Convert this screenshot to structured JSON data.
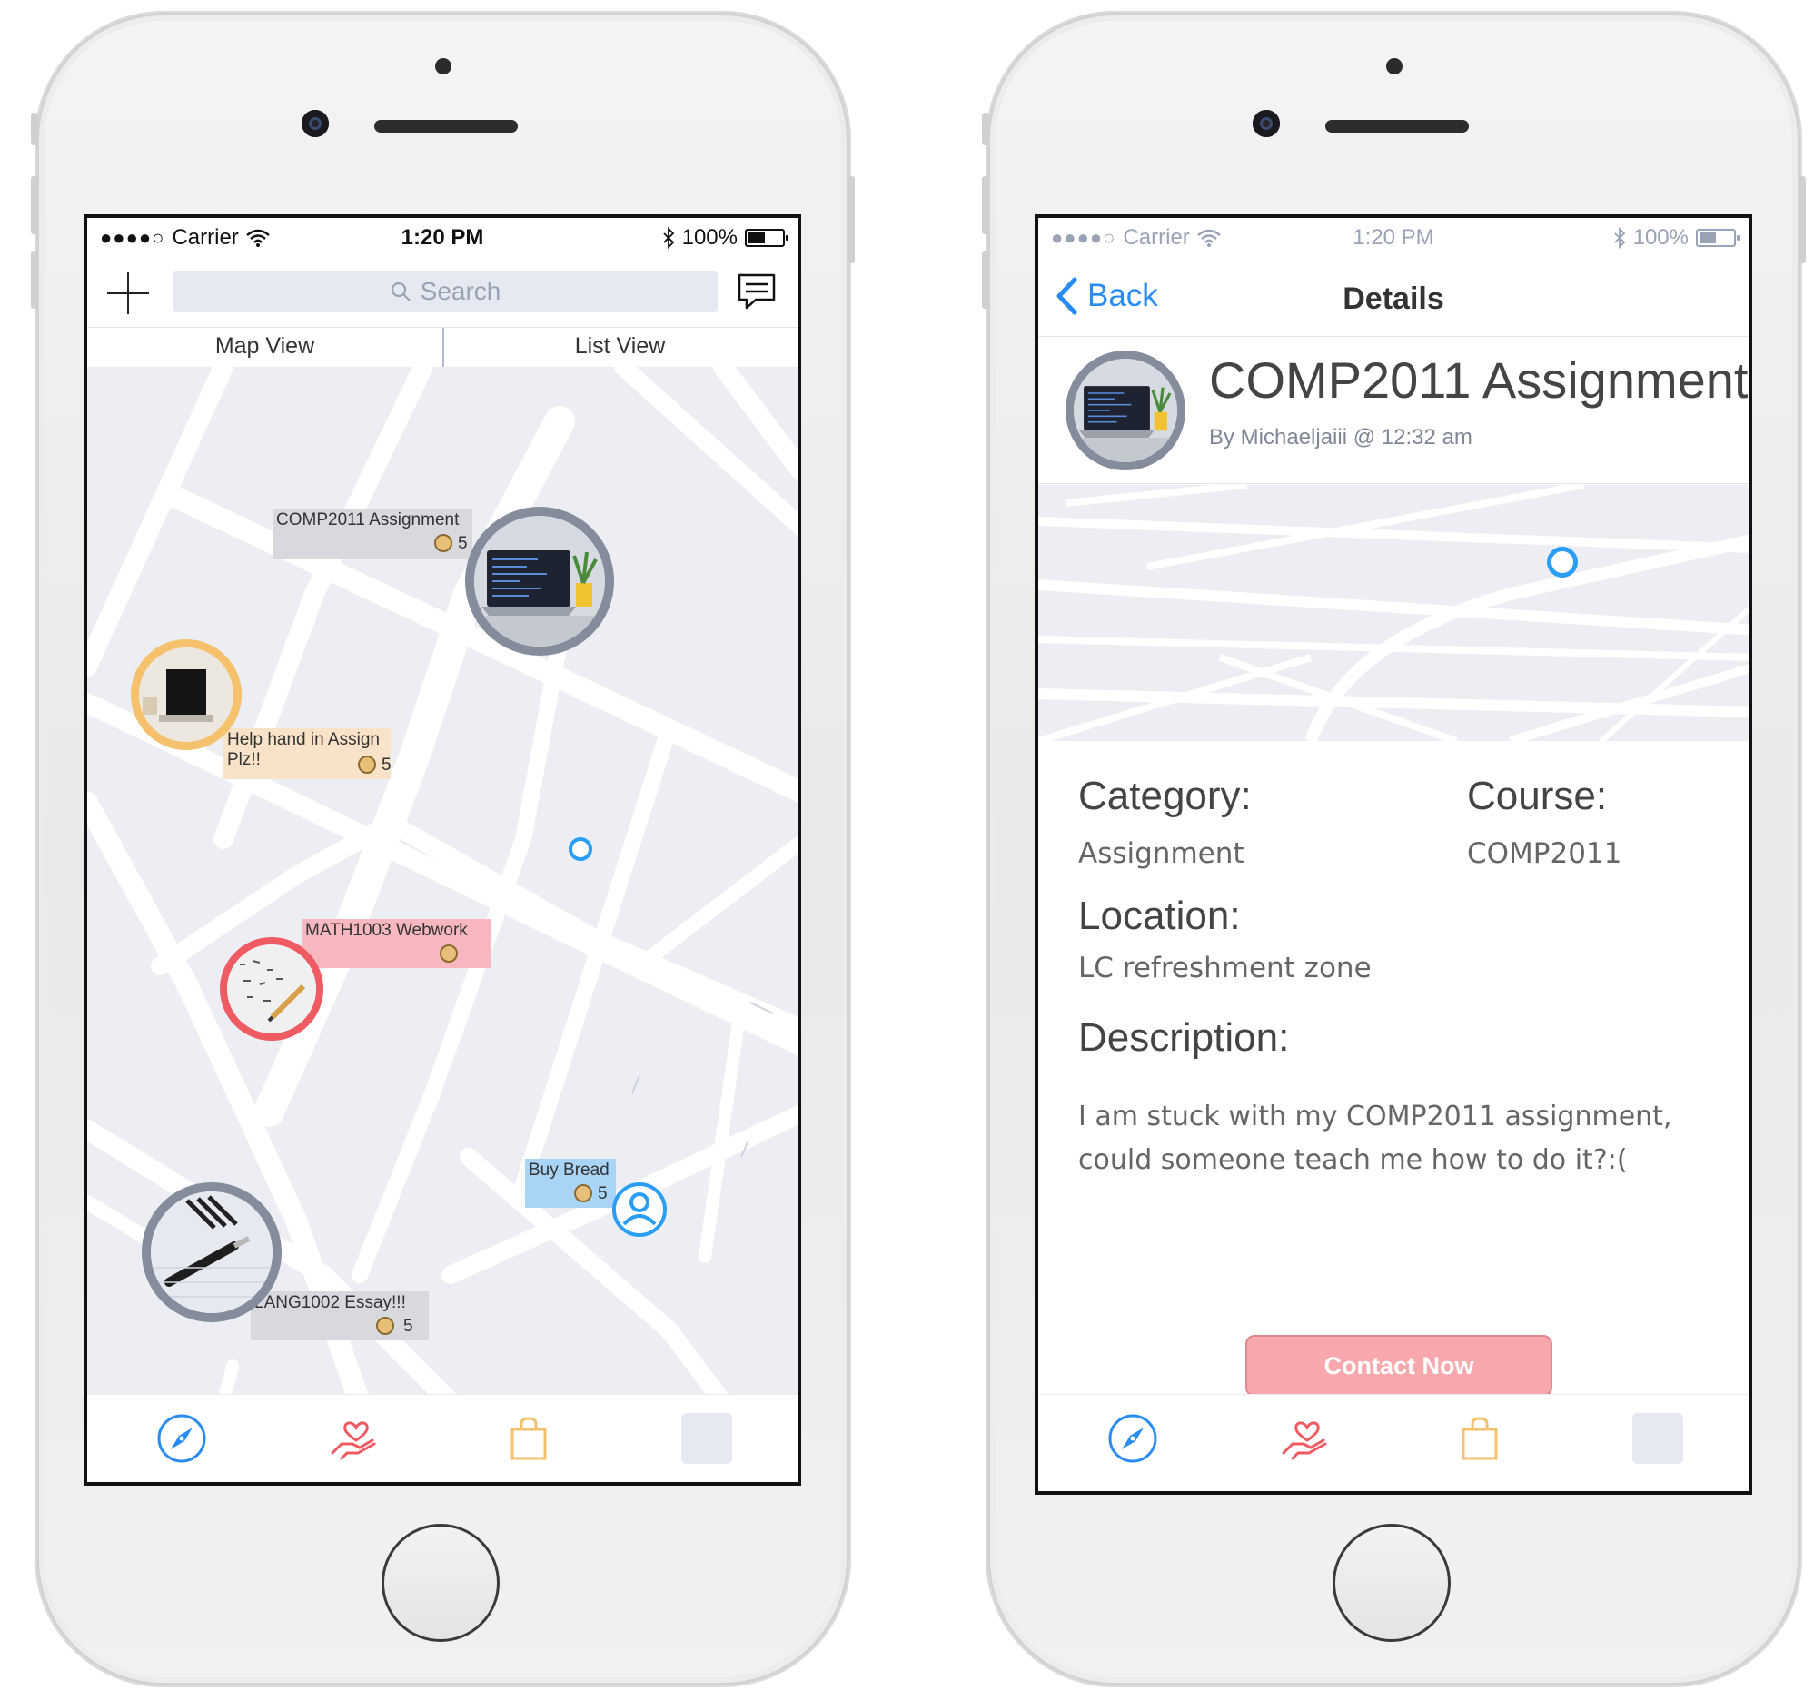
{
  "status_bar": {
    "signal": "●●●●○",
    "carrier": "Carrier",
    "time": "1:20 PM",
    "battery": "100%"
  },
  "map_screen": {
    "search": {
      "placeholder": "Search"
    },
    "tabs": [
      "Map View",
      "List View"
    ],
    "pins": [
      {
        "title": "COMP2011 Assignment",
        "points": "5",
        "color": "#d7d9df"
      },
      {
        "title": "Help hand in Assign Plz!!",
        "points": "5",
        "color": "#f8e3c8"
      },
      {
        "title": "MATH1003 Webwork",
        "points": "",
        "color": "#f6b8be"
      },
      {
        "title": "Buy Bread",
        "points": "5",
        "color": "#a8d5f6"
      },
      {
        "title": "LANG1002 Essay!!!",
        "points": "5",
        "color": "#d7d9df"
      }
    ]
  },
  "details_screen": {
    "back_label": "Back",
    "title": "Details",
    "post_title": "COMP2011 Assignment",
    "post_meta": "By Michaeljaiii @ 12:32 am",
    "category_label": "Category:",
    "category_value": "Assignment",
    "course_label": "Course:",
    "course_value": "COMP2011",
    "location_label": "Location:",
    "location_value": "LC refreshment zone",
    "description_label": "Description:",
    "description_value": "I am stuck with my COMP2011 assignment, could someone teach me how to do it?:(",
    "contact_button": "Contact Now"
  },
  "tab_bar": {
    "icons": [
      "compass-icon",
      "heart-hand-icon",
      "shopping-bag-icon",
      "profile-placeholder-icon"
    ]
  },
  "colors": {
    "accent_blue": "#2a8cf0",
    "heart_red": "#ef5b62",
    "bag_orange": "#f5c16c",
    "contact_pink": "#f8a8ad",
    "map_bg": "#eceef3"
  }
}
